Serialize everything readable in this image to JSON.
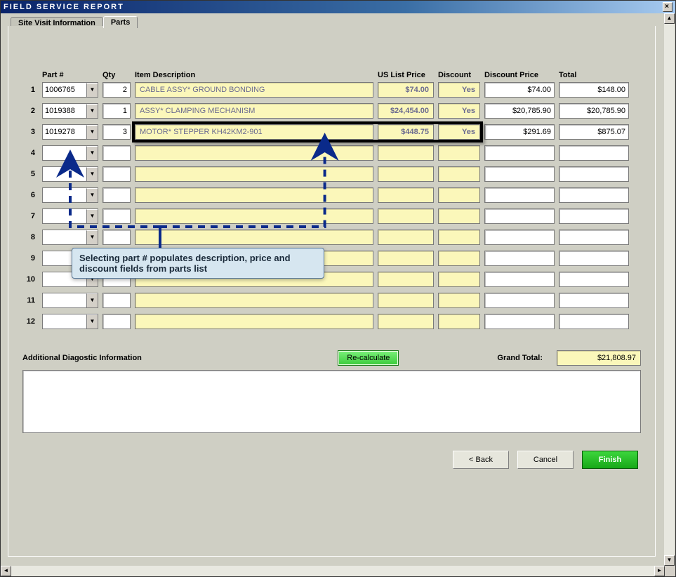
{
  "window": {
    "title": "FIELD SERVICE REPORT",
    "tabs": [
      "Site Visit Information",
      "Parts"
    ],
    "active_tab": 1
  },
  "columns": {
    "part": "Part #",
    "qty": "Qty",
    "desc": "Item Description",
    "lprice": "US List Price",
    "disc": "Discount",
    "dprice": "Discount Price",
    "total": "Total"
  },
  "rows": [
    {
      "n": "1",
      "part": "1006765",
      "qty": "2",
      "desc": "CABLE ASSY* GROUND BONDING",
      "lprice": "$74.00",
      "disc": "Yes",
      "dprice": "$74.00",
      "total": "$148.00"
    },
    {
      "n": "2",
      "part": "1019388",
      "qty": "1",
      "desc": "ASSY* CLAMPING MECHANISM",
      "lprice": "$24,454.00",
      "disc": "Yes",
      "dprice": "$20,785.90",
      "total": "$20,785.90"
    },
    {
      "n": "3",
      "part": "1019278",
      "qty": "3",
      "desc": "MOTOR* STEPPER KH42KM2-901",
      "lprice": "$448.75",
      "disc": "Yes",
      "dprice": "$291.69",
      "total": "$875.07"
    },
    {
      "n": "4",
      "part": "",
      "qty": "",
      "desc": "",
      "lprice": "",
      "disc": "",
      "dprice": "",
      "total": ""
    },
    {
      "n": "5",
      "part": "",
      "qty": "",
      "desc": "",
      "lprice": "",
      "disc": "",
      "dprice": "",
      "total": ""
    },
    {
      "n": "6",
      "part": "",
      "qty": "",
      "desc": "",
      "lprice": "",
      "disc": "",
      "dprice": "",
      "total": ""
    },
    {
      "n": "7",
      "part": "",
      "qty": "",
      "desc": "",
      "lprice": "",
      "disc": "",
      "dprice": "",
      "total": ""
    },
    {
      "n": "8",
      "part": "",
      "qty": "",
      "desc": "",
      "lprice": "",
      "disc": "",
      "dprice": "",
      "total": ""
    },
    {
      "n": "9",
      "part": "",
      "qty": "",
      "desc": "",
      "lprice": "",
      "disc": "",
      "dprice": "",
      "total": ""
    },
    {
      "n": "10",
      "part": "",
      "qty": "",
      "desc": "",
      "lprice": "",
      "disc": "",
      "dprice": "",
      "total": ""
    },
    {
      "n": "11",
      "part": "",
      "qty": "",
      "desc": "",
      "lprice": "",
      "disc": "",
      "dprice": "",
      "total": ""
    },
    {
      "n": "12",
      "part": "",
      "qty": "",
      "desc": "",
      "lprice": "",
      "disc": "",
      "dprice": "",
      "total": ""
    }
  ],
  "recalculate_label": "Re-calculate",
  "additional_label": "Additional Diagostic Information",
  "grand_total_label": "Grand Total:",
  "grand_total_value": "$21,808.97",
  "callout_text": "Selecting part # populates description, price and discount fields from parts list",
  "buttons": {
    "back": "< Back",
    "cancel": "Cancel",
    "finish": "Finish"
  },
  "diagnostic_text": ""
}
